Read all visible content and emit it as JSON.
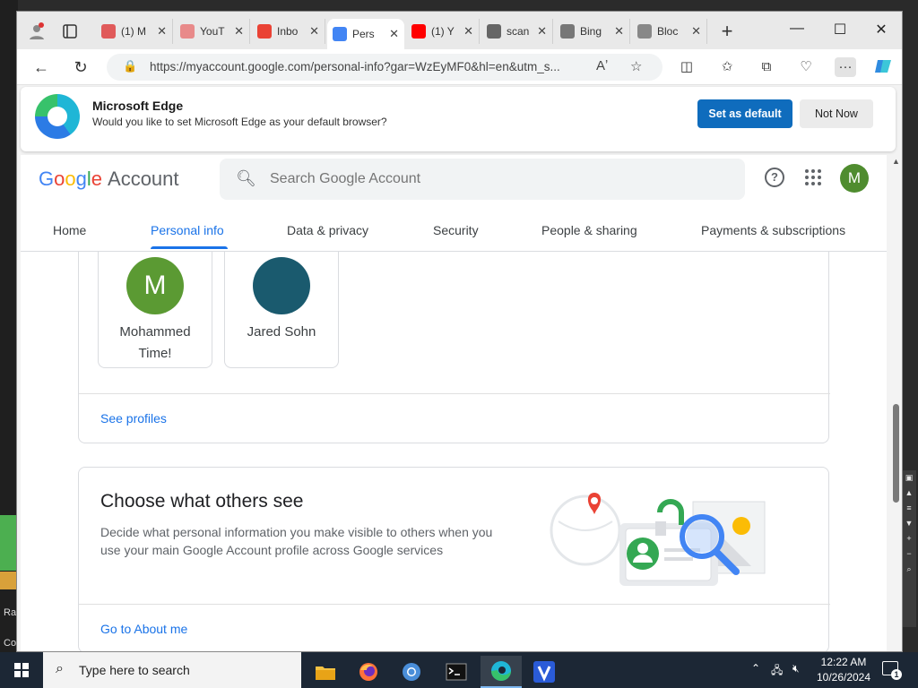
{
  "browser": {
    "tabs": [
      {
        "label": "(1) M",
        "icon": "youtube-icon",
        "color": "#e05a5a"
      },
      {
        "label": "YouT",
        "icon": "download-icon",
        "color": "#e88a8a"
      },
      {
        "label": "Inbo",
        "icon": "gmail-icon",
        "color": "#ea4335"
      },
      {
        "label": "Pers",
        "icon": "google-icon",
        "color": "#4285f4",
        "active": true
      },
      {
        "label": "(1) Y",
        "icon": "youtube-icon",
        "color": "#ff0000"
      },
      {
        "label": "scan",
        "icon": "scanner-icon",
        "color": "#666666"
      },
      {
        "label": "Bing",
        "icon": "search-icon",
        "color": "#777777"
      },
      {
        "label": "Bloc",
        "icon": "page-icon",
        "color": "#888888"
      }
    ],
    "url": "https://myaccount.google.com/personal-info?gar=WzEyMF0&hl=en&utm_s..."
  },
  "default_prompt": {
    "title": "Microsoft Edge",
    "message": "Would you like to set Microsoft Edge as your default browser?",
    "primary_label": "Set as default",
    "secondary_label": "Not Now"
  },
  "google": {
    "logo_letters": [
      "G",
      "o",
      "o",
      "g",
      "l",
      "e"
    ],
    "account_word": "Account",
    "search_placeholder": "Search Google Account",
    "help_glyph": "?",
    "avatar_initial": "M",
    "nav": [
      "Home",
      "Personal info",
      "Data & privacy",
      "Security",
      "People & sharing",
      "Payments & subscriptions"
    ],
    "active_nav": "Personal info"
  },
  "profiles": {
    "cards": [
      {
        "initial": "M",
        "name_line1": "Mohammed",
        "name_line2": "Time!",
        "color": "#5b9a33"
      },
      {
        "initial": "",
        "name_line1": "Jared Sohn",
        "name_line2": "",
        "color": "#1a5a6e"
      }
    ],
    "link_label": "See profiles"
  },
  "choose_section": {
    "title": "Choose what others see",
    "description": "Decide what personal information you make visible to others when you use your main Google Account profile across Google services",
    "link_label": "Go to About me"
  },
  "taskbar": {
    "search_placeholder": "Type here to search",
    "time": "12:22 AM",
    "date": "10/26/2024",
    "notification_count": "1",
    "apps": [
      "file-explorer-icon",
      "firefox-icon",
      "chromium-icon",
      "terminal-icon",
      "edge-icon",
      "v-app-icon"
    ]
  },
  "desktop": {
    "left_text_1": "Ra",
    "left_text_2": "Co"
  }
}
